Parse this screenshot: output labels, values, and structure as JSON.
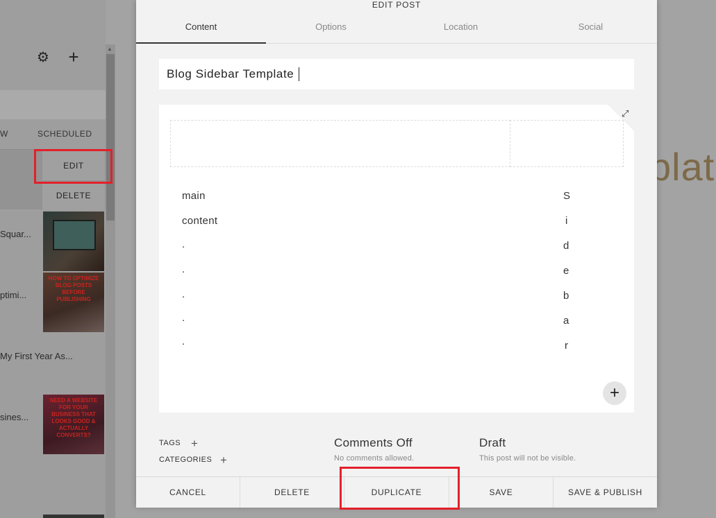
{
  "left_panel": {
    "gear_icon": "gear-icon",
    "plus_icon": "plus-icon",
    "column_partial": "W",
    "column_scheduled": "SCHEDULED",
    "edit_label": "EDIT",
    "delete_label": "DELETE",
    "items": [
      "Squar...",
      "ptimi...",
      "My First Year As...",
      "sines..."
    ],
    "thumb2_text": "HOW TO OPTIMIZE BLOG POSTS BEFORE PUBLISHING",
    "thumb3_text": "NEED A WEBSITE FOR YOUR BUSINESS THAT LOOKS GOOD & ACTUALLY CONVERTS?"
  },
  "background_text": "plate",
  "dialog": {
    "title": "EDIT POST",
    "tabs": [
      {
        "label": "Content"
      },
      {
        "label": "Options"
      },
      {
        "label": "Location"
      },
      {
        "label": "Social"
      }
    ],
    "post_title": "Blog Sidebar Template",
    "editor": {
      "main_lines": [
        "main",
        "content",
        ".",
        ".",
        ".",
        ".",
        "."
      ],
      "sidebar_letters": [
        "S",
        "i",
        "d",
        "e",
        "b",
        "a",
        "r"
      ]
    },
    "meta": {
      "tags_label": "TAGS",
      "categories_label": "CATEGORIES",
      "comments_title": "Comments Off",
      "comments_sub": "No comments allowed.",
      "status_title": "Draft",
      "status_sub": "This post will not be visible."
    },
    "footer": {
      "cancel": "CANCEL",
      "delete": "DELETE",
      "duplicate": "DUPLICATE",
      "save": "SAVE",
      "save_publish": "SAVE & PUBLISH"
    }
  },
  "colors": {
    "highlight": "#e3202a",
    "dialog_bg": "#f2f2f2",
    "overlay": "#a3a3a3"
  }
}
